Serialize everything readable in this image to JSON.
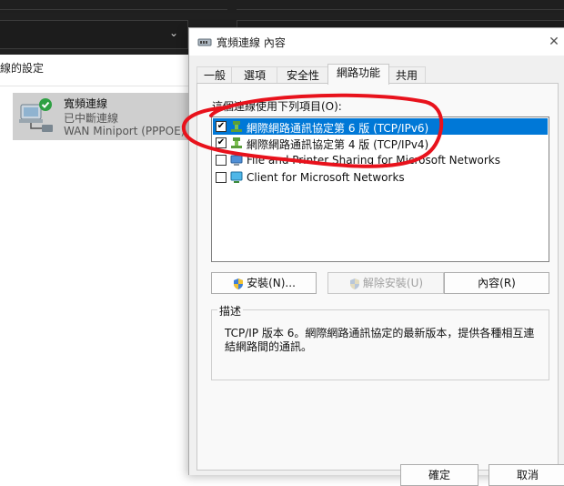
{
  "background": {
    "command_text": "線的設定",
    "connection": {
      "name": "寬頻連線",
      "status": "已中斷連線",
      "device": "WAN Miniport (PPPOE)"
    }
  },
  "dialog": {
    "title": "寬頻連線 內容",
    "tabs": [
      {
        "label": "一般"
      },
      {
        "label": "選項"
      },
      {
        "label": "安全性"
      },
      {
        "label": "網路功能"
      },
      {
        "label": "共用"
      }
    ],
    "active_tab": "網路功能",
    "uses_label": "這個連線使用下列項目(O):",
    "items": [
      {
        "label": "網際網路通訊協定第 6 版 (TCP/IPv6)",
        "checked": true,
        "selected": true,
        "icon": "protocol-icon"
      },
      {
        "label": "網際網路通訊協定第 4 版 (TCP/IPv4)",
        "checked": true,
        "selected": false,
        "icon": "protocol-icon"
      },
      {
        "label": "File and Printer Sharing for Microsoft Networks",
        "checked": false,
        "selected": false,
        "icon": "service-icon"
      },
      {
        "label": "Client for Microsoft Networks",
        "checked": false,
        "selected": false,
        "icon": "client-icon"
      }
    ],
    "buttons": {
      "install": "安裝(N)...",
      "uninstall": "解除安裝(U)",
      "properties": "內容(R)"
    },
    "description": {
      "title": "描述",
      "text": "TCP/IP 版本 6。網際網路通訊協定的最新版本，提供各種相互連結網路間的通訊。"
    },
    "footer": {
      "ok": "確定",
      "cancel": "取消"
    }
  },
  "colors": {
    "selection": "#0078d7",
    "annotation": "#e8121c"
  }
}
